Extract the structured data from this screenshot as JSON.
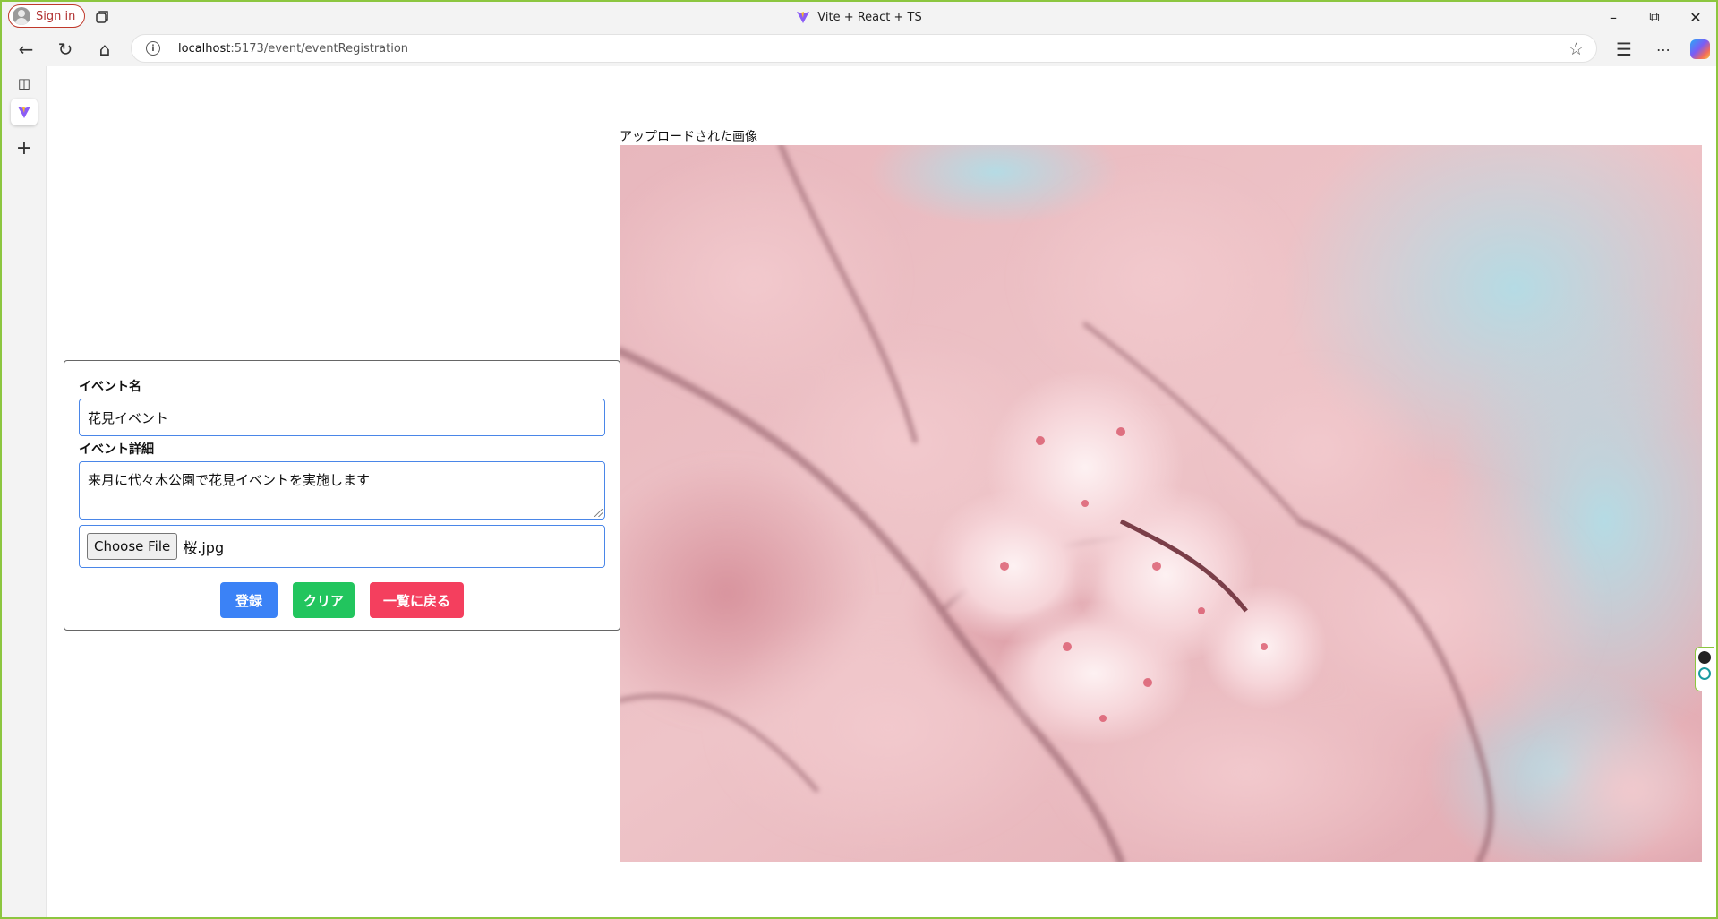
{
  "browser": {
    "signin_label": "Sign in",
    "window_title": "Vite + React + TS",
    "url_host": "localhost",
    "url_path": ":5173/event/eventRegistration"
  },
  "form": {
    "event_name_label": "イベント名",
    "event_name_value": "花見イベント",
    "event_detail_label": "イベント詳細",
    "event_detail_value": "来月に代々木公園で花見イベントを実施します",
    "choose_file_label": "Choose File",
    "file_name": "桜.jpg",
    "register_button": "登録",
    "clear_button": "クリア",
    "back_button": "一覧に戻る"
  },
  "preview": {
    "caption": "アップロードされた画像"
  },
  "colors": {
    "register": "#3b82f6",
    "clear": "#22c55e",
    "back": "#f43f5e",
    "input_border": "#4a86e8"
  }
}
